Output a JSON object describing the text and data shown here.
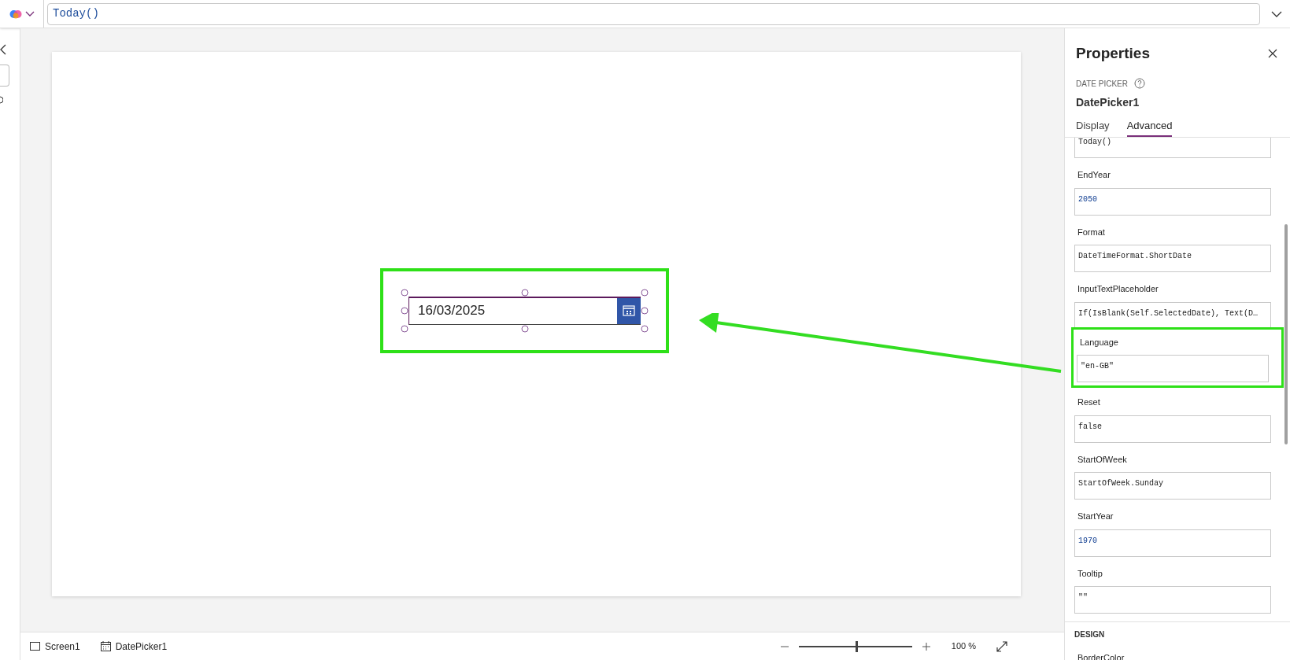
{
  "formula_bar": {
    "value": "Today()"
  },
  "canvas": {
    "date_picker": {
      "value": "16/03/2025",
      "selected": true
    }
  },
  "properties": {
    "title": "Properties",
    "control_type": "DATE PICKER",
    "control_name": "DatePicker1",
    "tabs": [
      {
        "label": "Display",
        "selected": false
      },
      {
        "label": "Advanced",
        "selected": true
      }
    ],
    "fields": [
      {
        "value": "Today()",
        "kind": "text",
        "highlighted": false
      },
      {
        "label": "EndYear",
        "value": "2050",
        "kind": "number",
        "highlighted": false
      },
      {
        "label": "Format",
        "value": "DateTimeFormat.ShortDate",
        "kind": "text",
        "highlighted": false
      },
      {
        "label": "InputTextPlaceholder",
        "value": "If(IsBlank(Self.SelectedDate), Text(D…",
        "kind": "text",
        "highlighted": false
      },
      {
        "label": "Language",
        "value": "\"en-GB\"",
        "kind": "text",
        "highlighted": true
      },
      {
        "label": "Reset",
        "value": "false",
        "kind": "text",
        "highlighted": false
      },
      {
        "label": "StartOfWeek",
        "value": "StartOfWeek.Sunday",
        "kind": "text",
        "highlighted": false
      },
      {
        "label": "StartYear",
        "value": "1970",
        "kind": "number",
        "highlighted": false
      },
      {
        "label": "Tooltip",
        "value": "\"\"",
        "kind": "text",
        "highlighted": false
      }
    ],
    "section": "DESIGN",
    "next_label": "BorderColor"
  },
  "status_bar": {
    "breadcrumbs": [
      {
        "label": "Screen1",
        "kind": "screen"
      },
      {
        "label": "DatePicker1",
        "kind": "datepicker"
      }
    ],
    "zoom": {
      "level": 0.5,
      "reading": "100 %"
    }
  }
}
